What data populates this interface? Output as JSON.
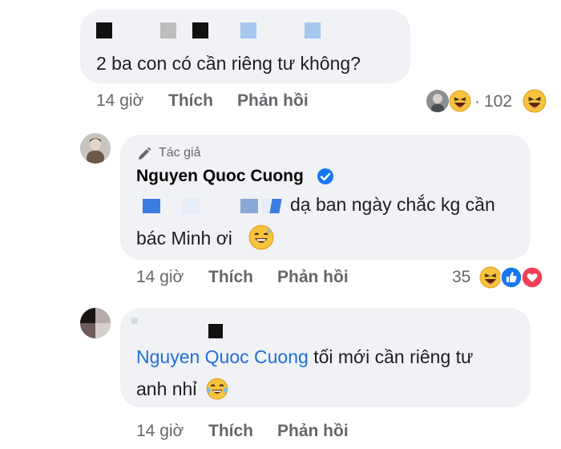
{
  "comments": [
    {
      "text": "2 ba con có cần riêng tư không?",
      "time": "14 giờ",
      "like": "Thích",
      "reply": "Phản hồi",
      "reaction_count": "102"
    },
    {
      "author_badge": "Tác giả",
      "author": "Nguyen Quoc Cuong",
      "text_line1": "dạ ban ngày chắc kg cần",
      "text_line2": "bác Minh ơi",
      "time": "14 giờ",
      "like": "Thích",
      "reply": "Phản hồi",
      "reaction_count": "35"
    },
    {
      "mention": "Nguyen Quoc Cuong",
      "text_line1_rest": " tối mới cần riêng tư",
      "text_line2": "anh nhỉ",
      "time": "14 giờ",
      "like": "Thích",
      "reply": "Phản hồi"
    }
  ],
  "colors": {
    "bubble": "#f0f2f5",
    "meta": "#65676b",
    "mention": "#216fdb",
    "verified": "#1877f2",
    "like_blue": "#1877f2",
    "love_red": "#f33e58"
  },
  "icons": [
    "pen-icon",
    "verified-icon",
    "laugh-emoji-icon",
    "sweat-smile-emoji-icon",
    "tears-of-joy-emoji-icon",
    "like-reaction-icon",
    "love-reaction-icon"
  ]
}
